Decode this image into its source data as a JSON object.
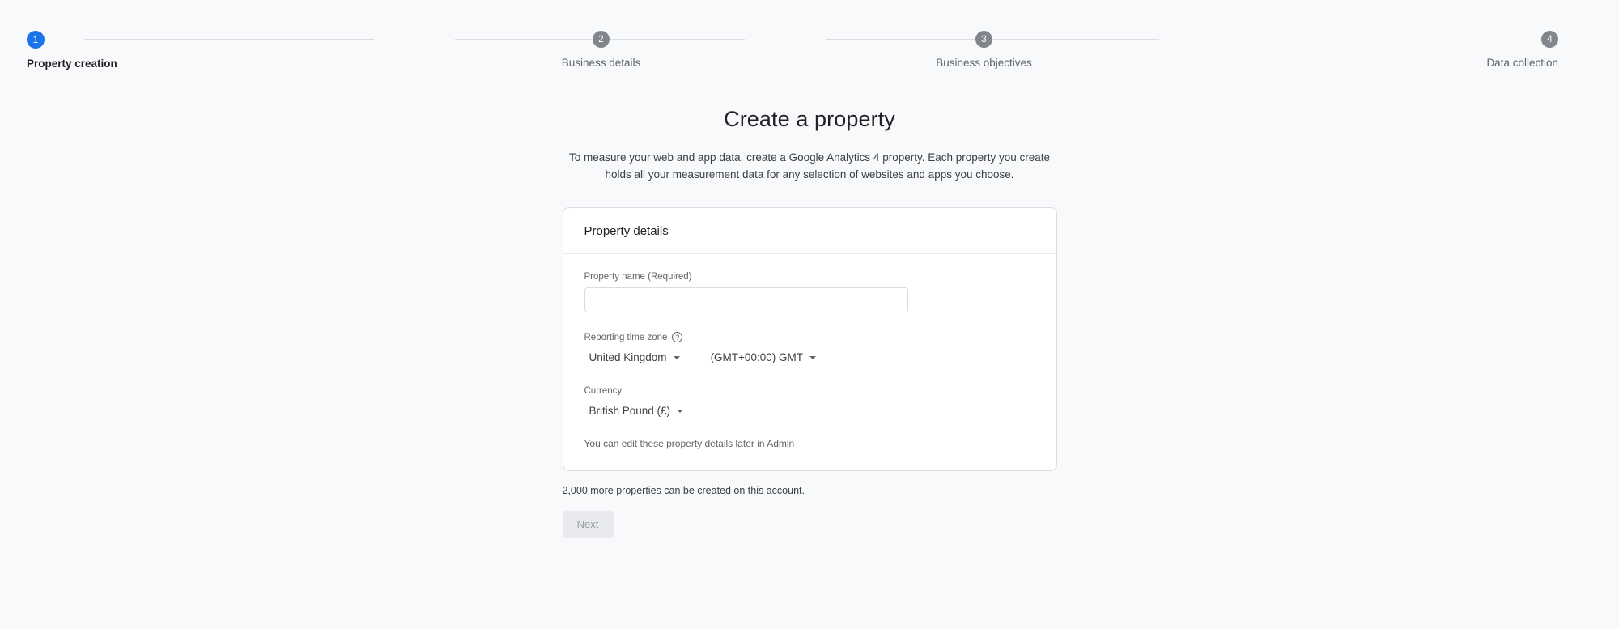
{
  "stepper": {
    "steps": [
      {
        "number": "1",
        "label": "Property creation",
        "state": "active"
      },
      {
        "number": "2",
        "label": "Business details",
        "state": "inactive"
      },
      {
        "number": "3",
        "label": "Business objectives",
        "state": "inactive"
      },
      {
        "number": "4",
        "label": "Data collection",
        "state": "inactive"
      }
    ],
    "active_color": "#1a73e8",
    "inactive_color": "#80868b",
    "connector_color": "#dadce0"
  },
  "main": {
    "title": "Create a property",
    "description": "To measure your web and app data, create a Google Analytics 4 property. Each property you create holds all your measurement data for any selection of websites and apps you choose."
  },
  "card": {
    "header": "Property details",
    "property_name": {
      "label": "Property name (Required)",
      "value": "",
      "placeholder": ""
    },
    "reporting_time_zone": {
      "label": "Reporting time zone",
      "help_icon": "help-circle-icon",
      "country_value": "United Kingdom",
      "offset_value": "(GMT+00:00) GMT"
    },
    "currency": {
      "label": "Currency",
      "value": "British Pound (£)"
    },
    "helper_note": "You can edit these property details later in Admin"
  },
  "footer": {
    "account_note": "2,000 more properties can be created on this account.",
    "next_label": "Next",
    "next_disabled": true
  }
}
